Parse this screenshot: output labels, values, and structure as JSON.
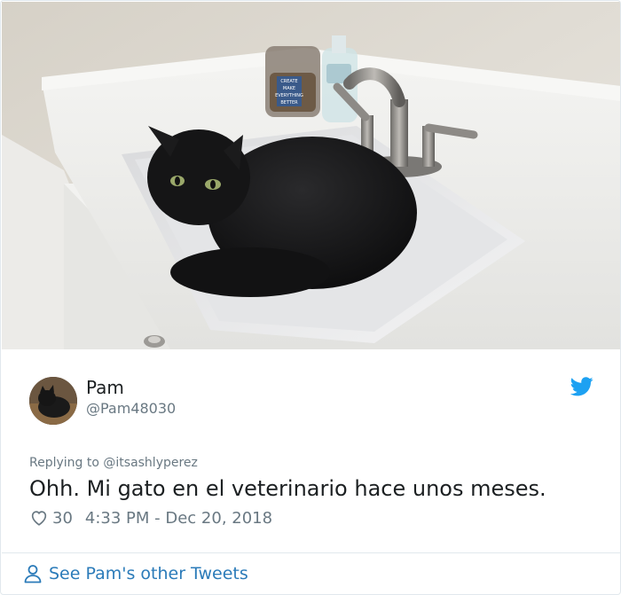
{
  "photo": {
    "jar_label_lines": [
      "CREATE",
      "MAKE",
      "EVERYTHING",
      "BETTER"
    ]
  },
  "tweet": {
    "author_name": "Pam",
    "author_handle": "@Pam48030",
    "reply_prefix": "Replying to",
    "reply_to": "@itsashlyperez",
    "text": "Ohh. Mi gato en el veterinario hace unos meses.",
    "likes": "30",
    "timestamp": "4:33 PM - Dec 20, 2018"
  },
  "footer": {
    "link_label": "See Pam's other Tweets"
  },
  "colors": {
    "twitter_blue": "#1da1f2",
    "link_blue": "#2b7bb9",
    "muted_gray": "#697882"
  },
  "icons": [
    "twitter-bird-icon",
    "heart-icon",
    "person-icon"
  ]
}
